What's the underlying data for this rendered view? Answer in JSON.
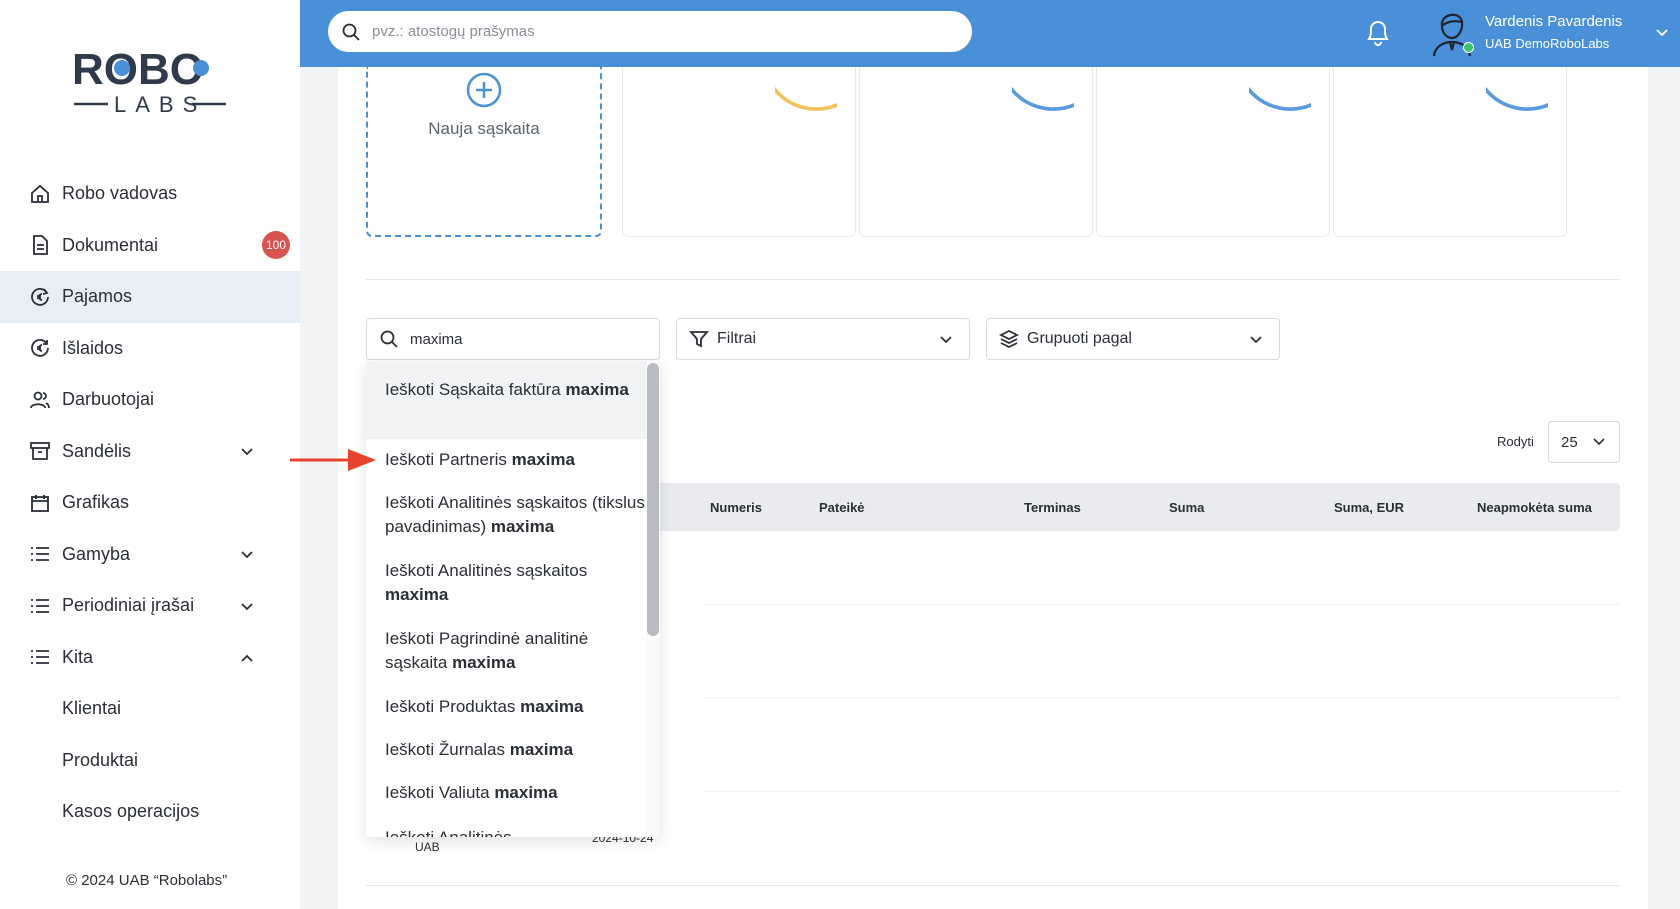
{
  "logo": {
    "brand": "ROBO",
    "sub": "LABS"
  },
  "sidebar": {
    "items": [
      {
        "label": "Robo vadovas",
        "icon": "home-icon"
      },
      {
        "label": "Dokumentai",
        "icon": "document-icon",
        "badge": "100"
      },
      {
        "label": "Pajamos",
        "icon": "euro-income-icon",
        "active": true
      },
      {
        "label": "Išlaidos",
        "icon": "euro-expense-icon"
      },
      {
        "label": "Darbuotojai",
        "icon": "users-icon"
      },
      {
        "label": "Sandėlis",
        "icon": "archive-icon",
        "chevron": "down"
      },
      {
        "label": "Grafikas",
        "icon": "calendar-icon"
      },
      {
        "label": "Gamyba",
        "icon": "list-icon",
        "chevron": "down"
      },
      {
        "label": "Periodiniai įrašai",
        "icon": "list-icon",
        "chevron": "down"
      },
      {
        "label": "Kita",
        "icon": "list-icon",
        "chevron": "up"
      }
    ],
    "subitems": [
      "Klientai",
      "Produktai",
      "Kasos operacijos"
    ],
    "copyright": "© 2024 UAB “Robolabs”"
  },
  "topbar": {
    "search_placeholder": "pvz.: atostogų prašymas",
    "user_name": "Vardenis Pavardenis",
    "user_company": "UAB DemoRoboLabs",
    "accent": "#4a90d9"
  },
  "main": {
    "new_invoice_label": "Nauja sąskaita",
    "table_search_value": "maxima",
    "filters_label": "Filtrai",
    "group_label": "Grupuoti pagal",
    "rodyti_label": "Rodyti",
    "rodyti_value": "25",
    "columns": [
      "Numeris",
      "Pateikė",
      "Terminas",
      "Suma",
      "Suma, EUR",
      "Neapmokėta suma"
    ],
    "row_fragments": {
      "company": "UAB",
      "date": "2024-10-24"
    }
  },
  "dropdown": {
    "query": "maxima",
    "items": [
      {
        "prefix": "Ieškoti Sąskaita faktūra",
        "highlighted": true
      },
      {
        "prefix": "Ieškoti Partneris"
      },
      {
        "prefix": "Ieškoti Analitinės sąskaitos (tikslus pavadinimas)"
      },
      {
        "prefix": "Ieškoti Analitinės sąskaitos"
      },
      {
        "prefix": "Ieškoti Pagrindinė analitinė sąskaita"
      },
      {
        "prefix": "Ieškoti Produktas"
      },
      {
        "prefix": "Ieškoti Žurnalas"
      },
      {
        "prefix": "Ieškoti Valiuta"
      },
      {
        "prefix": "Ieškoti Analitinės"
      }
    ]
  },
  "annotation": {
    "arrow_color": "#e8432e"
  }
}
